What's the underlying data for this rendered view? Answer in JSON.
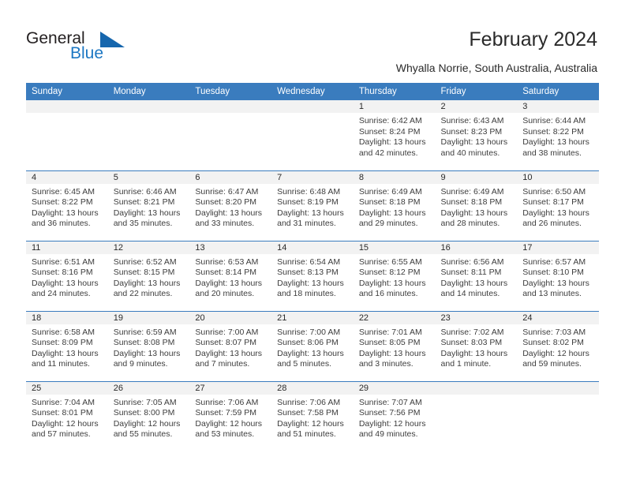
{
  "brand": {
    "name_part1": "General",
    "name_part2": "Blue",
    "triangle_color": "#1666ad",
    "blue_color": "#1c77c3"
  },
  "header": {
    "title": "February 2024",
    "location": "Whyalla Norrie, South Australia, Australia"
  },
  "theme": {
    "header_blue": "#3a7cbe",
    "daynum_band": "#f2f2f2",
    "text": "#3d3d3d"
  },
  "labels": {
    "sunrise_prefix": "Sunrise:",
    "sunset_prefix": "Sunset:",
    "daylight_prefix": "Daylight:"
  },
  "weekdays": [
    "Sunday",
    "Monday",
    "Tuesday",
    "Wednesday",
    "Thursday",
    "Friday",
    "Saturday"
  ],
  "weeks": [
    [
      {
        "day": "",
        "blank": true
      },
      {
        "day": "",
        "blank": true
      },
      {
        "day": "",
        "blank": true
      },
      {
        "day": "",
        "blank": true
      },
      {
        "day": "1",
        "sunrise": "Sunrise: 6:42 AM",
        "sunset": "Sunset: 8:24 PM",
        "daylight_line1": "Daylight: 13 hours",
        "daylight_line2": "and 42 minutes."
      },
      {
        "day": "2",
        "sunrise": "Sunrise: 6:43 AM",
        "sunset": "Sunset: 8:23 PM",
        "daylight_line1": "Daylight: 13 hours",
        "daylight_line2": "and 40 minutes."
      },
      {
        "day": "3",
        "sunrise": "Sunrise: 6:44 AM",
        "sunset": "Sunset: 8:22 PM",
        "daylight_line1": "Daylight: 13 hours",
        "daylight_line2": "and 38 minutes."
      }
    ],
    [
      {
        "day": "4",
        "sunrise": "Sunrise: 6:45 AM",
        "sunset": "Sunset: 8:22 PM",
        "daylight_line1": "Daylight: 13 hours",
        "daylight_line2": "and 36 minutes."
      },
      {
        "day": "5",
        "sunrise": "Sunrise: 6:46 AM",
        "sunset": "Sunset: 8:21 PM",
        "daylight_line1": "Daylight: 13 hours",
        "daylight_line2": "and 35 minutes."
      },
      {
        "day": "6",
        "sunrise": "Sunrise: 6:47 AM",
        "sunset": "Sunset: 8:20 PM",
        "daylight_line1": "Daylight: 13 hours",
        "daylight_line2": "and 33 minutes."
      },
      {
        "day": "7",
        "sunrise": "Sunrise: 6:48 AM",
        "sunset": "Sunset: 8:19 PM",
        "daylight_line1": "Daylight: 13 hours",
        "daylight_line2": "and 31 minutes."
      },
      {
        "day": "8",
        "sunrise": "Sunrise: 6:49 AM",
        "sunset": "Sunset: 8:18 PM",
        "daylight_line1": "Daylight: 13 hours",
        "daylight_line2": "and 29 minutes."
      },
      {
        "day": "9",
        "sunrise": "Sunrise: 6:49 AM",
        "sunset": "Sunset: 8:18 PM",
        "daylight_line1": "Daylight: 13 hours",
        "daylight_line2": "and 28 minutes."
      },
      {
        "day": "10",
        "sunrise": "Sunrise: 6:50 AM",
        "sunset": "Sunset: 8:17 PM",
        "daylight_line1": "Daylight: 13 hours",
        "daylight_line2": "and 26 minutes."
      }
    ],
    [
      {
        "day": "11",
        "sunrise": "Sunrise: 6:51 AM",
        "sunset": "Sunset: 8:16 PM",
        "daylight_line1": "Daylight: 13 hours",
        "daylight_line2": "and 24 minutes."
      },
      {
        "day": "12",
        "sunrise": "Sunrise: 6:52 AM",
        "sunset": "Sunset: 8:15 PM",
        "daylight_line1": "Daylight: 13 hours",
        "daylight_line2": "and 22 minutes."
      },
      {
        "day": "13",
        "sunrise": "Sunrise: 6:53 AM",
        "sunset": "Sunset: 8:14 PM",
        "daylight_line1": "Daylight: 13 hours",
        "daylight_line2": "and 20 minutes."
      },
      {
        "day": "14",
        "sunrise": "Sunrise: 6:54 AM",
        "sunset": "Sunset: 8:13 PM",
        "daylight_line1": "Daylight: 13 hours",
        "daylight_line2": "and 18 minutes."
      },
      {
        "day": "15",
        "sunrise": "Sunrise: 6:55 AM",
        "sunset": "Sunset: 8:12 PM",
        "daylight_line1": "Daylight: 13 hours",
        "daylight_line2": "and 16 minutes."
      },
      {
        "day": "16",
        "sunrise": "Sunrise: 6:56 AM",
        "sunset": "Sunset: 8:11 PM",
        "daylight_line1": "Daylight: 13 hours",
        "daylight_line2": "and 14 minutes."
      },
      {
        "day": "17",
        "sunrise": "Sunrise: 6:57 AM",
        "sunset": "Sunset: 8:10 PM",
        "daylight_line1": "Daylight: 13 hours",
        "daylight_line2": "and 13 minutes."
      }
    ],
    [
      {
        "day": "18",
        "sunrise": "Sunrise: 6:58 AM",
        "sunset": "Sunset: 8:09 PM",
        "daylight_line1": "Daylight: 13 hours",
        "daylight_line2": "and 11 minutes."
      },
      {
        "day": "19",
        "sunrise": "Sunrise: 6:59 AM",
        "sunset": "Sunset: 8:08 PM",
        "daylight_line1": "Daylight: 13 hours",
        "daylight_line2": "and 9 minutes."
      },
      {
        "day": "20",
        "sunrise": "Sunrise: 7:00 AM",
        "sunset": "Sunset: 8:07 PM",
        "daylight_line1": "Daylight: 13 hours",
        "daylight_line2": "and 7 minutes."
      },
      {
        "day": "21",
        "sunrise": "Sunrise: 7:00 AM",
        "sunset": "Sunset: 8:06 PM",
        "daylight_line1": "Daylight: 13 hours",
        "daylight_line2": "and 5 minutes."
      },
      {
        "day": "22",
        "sunrise": "Sunrise: 7:01 AM",
        "sunset": "Sunset: 8:05 PM",
        "daylight_line1": "Daylight: 13 hours",
        "daylight_line2": "and 3 minutes."
      },
      {
        "day": "23",
        "sunrise": "Sunrise: 7:02 AM",
        "sunset": "Sunset: 8:03 PM",
        "daylight_line1": "Daylight: 13 hours",
        "daylight_line2": "and 1 minute."
      },
      {
        "day": "24",
        "sunrise": "Sunrise: 7:03 AM",
        "sunset": "Sunset: 8:02 PM",
        "daylight_line1": "Daylight: 12 hours",
        "daylight_line2": "and 59 minutes."
      }
    ],
    [
      {
        "day": "25",
        "sunrise": "Sunrise: 7:04 AM",
        "sunset": "Sunset: 8:01 PM",
        "daylight_line1": "Daylight: 12 hours",
        "daylight_line2": "and 57 minutes."
      },
      {
        "day": "26",
        "sunrise": "Sunrise: 7:05 AM",
        "sunset": "Sunset: 8:00 PM",
        "daylight_line1": "Daylight: 12 hours",
        "daylight_line2": "and 55 minutes."
      },
      {
        "day": "27",
        "sunrise": "Sunrise: 7:06 AM",
        "sunset": "Sunset: 7:59 PM",
        "daylight_line1": "Daylight: 12 hours",
        "daylight_line2": "and 53 minutes."
      },
      {
        "day": "28",
        "sunrise": "Sunrise: 7:06 AM",
        "sunset": "Sunset: 7:58 PM",
        "daylight_line1": "Daylight: 12 hours",
        "daylight_line2": "and 51 minutes."
      },
      {
        "day": "29",
        "sunrise": "Sunrise: 7:07 AM",
        "sunset": "Sunset: 7:56 PM",
        "daylight_line1": "Daylight: 12 hours",
        "daylight_line2": "and 49 minutes."
      },
      {
        "day": "",
        "blank": true
      },
      {
        "day": "",
        "blank": true
      }
    ]
  ]
}
